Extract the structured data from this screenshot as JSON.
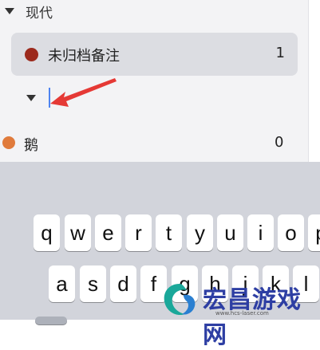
{
  "section": {
    "title": "现代"
  },
  "folders": [
    {
      "label": "未归档备注",
      "count": "1",
      "color": "#9c2a1d"
    }
  ],
  "new_folder": {
    "name_value": ""
  },
  "items": [
    {
      "label": "鹅",
      "count": "0",
      "color": "#e07b3c"
    }
  ],
  "keyboard": {
    "row1": [
      "q",
      "w",
      "e",
      "r",
      "t",
      "y",
      "u",
      "i",
      "o",
      "p"
    ],
    "row2": [
      "a",
      "s",
      "d",
      "f",
      "g",
      "h",
      "j",
      "k",
      "l"
    ]
  },
  "watermark": {
    "text": "宏昌游戏网",
    "url": "www.hcs-laser.com"
  },
  "colors": {
    "accent": "#4e84f0",
    "annotation_arrow": "#e53935"
  }
}
